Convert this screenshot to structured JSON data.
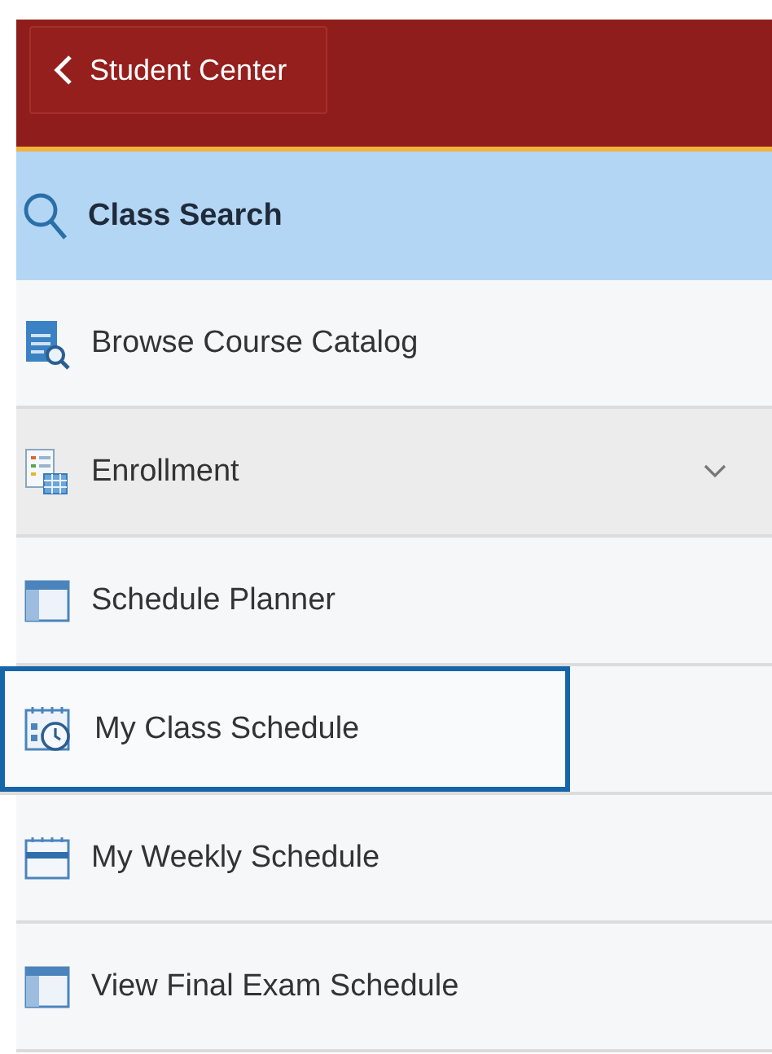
{
  "header": {
    "back_button": {
      "label": "Student Center"
    }
  },
  "menu": [
    {
      "label": "Class Search",
      "kind": "search",
      "selected": true,
      "focused": false
    },
    {
      "label": "Browse Course Catalog",
      "kind": "catalog",
      "selected": false,
      "focused": false
    },
    {
      "label": "Enrollment",
      "kind": "enroll",
      "selected": false,
      "focused": false,
      "expanded": false
    },
    {
      "label": "Schedule Planner",
      "kind": "window",
      "selected": false,
      "focused": false
    },
    {
      "label": "My Class Schedule",
      "kind": "clock",
      "selected": false,
      "focused": true
    },
    {
      "label": "My Weekly Schedule",
      "kind": "week",
      "selected": false,
      "focused": false
    },
    {
      "label": "View Final Exam Schedule",
      "kind": "window",
      "selected": false,
      "focused": false
    }
  ]
}
